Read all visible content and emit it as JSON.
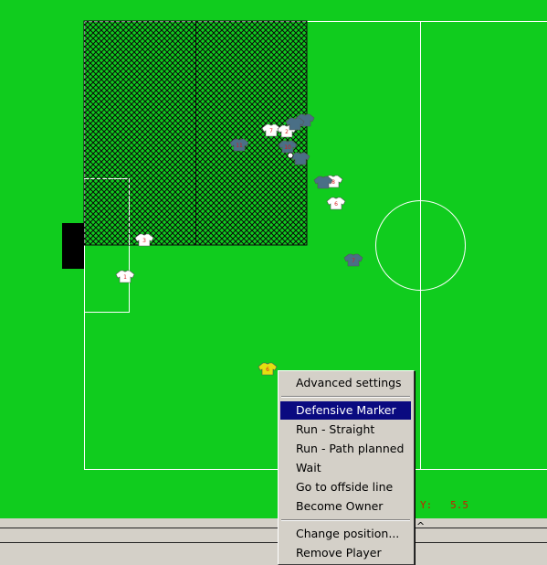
{
  "pitch": {
    "colors": {
      "grass": "#10cc1e",
      "lines": "#ffffff",
      "home": "#ffffff",
      "away": "#4a6f86",
      "keeper": "#e4e010",
      "number": "#d81e1e"
    },
    "home_players": [
      "7",
      "2",
      "8",
      "6",
      "3",
      "1"
    ],
    "away_players": [
      "",
      "",
      "11",
      "10",
      "",
      "",
      "7"
    ],
    "selected_player": "6"
  },
  "coordinates": {
    "y_label": "Y:",
    "y_value": "5.5"
  },
  "bottom_bar": {
    "caret": "^"
  },
  "context_menu": {
    "items": [
      {
        "id": "advanced-settings",
        "label": "Advanced settings"
      },
      {
        "id": "defensive-marker",
        "label": "Defensive Marker",
        "selected": true
      },
      {
        "id": "run-straight",
        "label": "Run - Straight"
      },
      {
        "id": "run-path-planned",
        "label": "Run - Path planned"
      },
      {
        "id": "wait",
        "label": "Wait"
      },
      {
        "id": "go-to-offside-line",
        "label": "Go to offside line"
      },
      {
        "id": "become-owner",
        "label": "Become Owner"
      },
      {
        "id": "change-position",
        "label": "Change position..."
      },
      {
        "id": "remove-player",
        "label": "Remove Player"
      }
    ]
  }
}
